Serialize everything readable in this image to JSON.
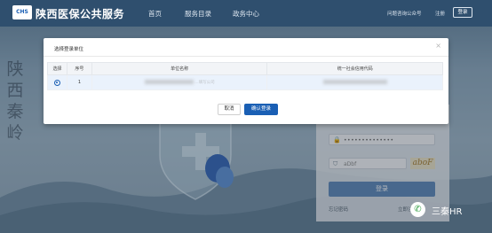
{
  "header": {
    "logo_text": "CHS",
    "site_title": "陕西医保公共服务",
    "nav": [
      "首页",
      "服务目录",
      "政务中心"
    ],
    "help_link": "问题咨询公众号",
    "register_link": "注册",
    "login_button": "登录"
  },
  "background": {
    "calligraphy": [
      "陕",
      "西",
      "秦",
      "岭"
    ]
  },
  "login_card": {
    "password_mask": "••••••••••••••",
    "captcha_placeholder": "aDbf",
    "captcha_image_text": "aboF",
    "submit_label": "登录",
    "forgot_link": "忘记密码",
    "register_link": "立即注册"
  },
  "modal": {
    "title": "选择登录单位",
    "close_glyph": "×",
    "columns": [
      "选择",
      "序号",
      "单位名称",
      "统一社会信用代码"
    ],
    "rows": [
      {
        "index": "1",
        "name_visible": "...填写公司"
      }
    ],
    "cancel_label": "取消",
    "confirm_label": "确认登录"
  },
  "watermark": {
    "icon": "wechat-icon",
    "text": "三秦HR"
  },
  "colors": {
    "nav_bar": "#2f4f6e",
    "primary": "#1a5fb4",
    "row_highlight": "#eaf2fc"
  }
}
